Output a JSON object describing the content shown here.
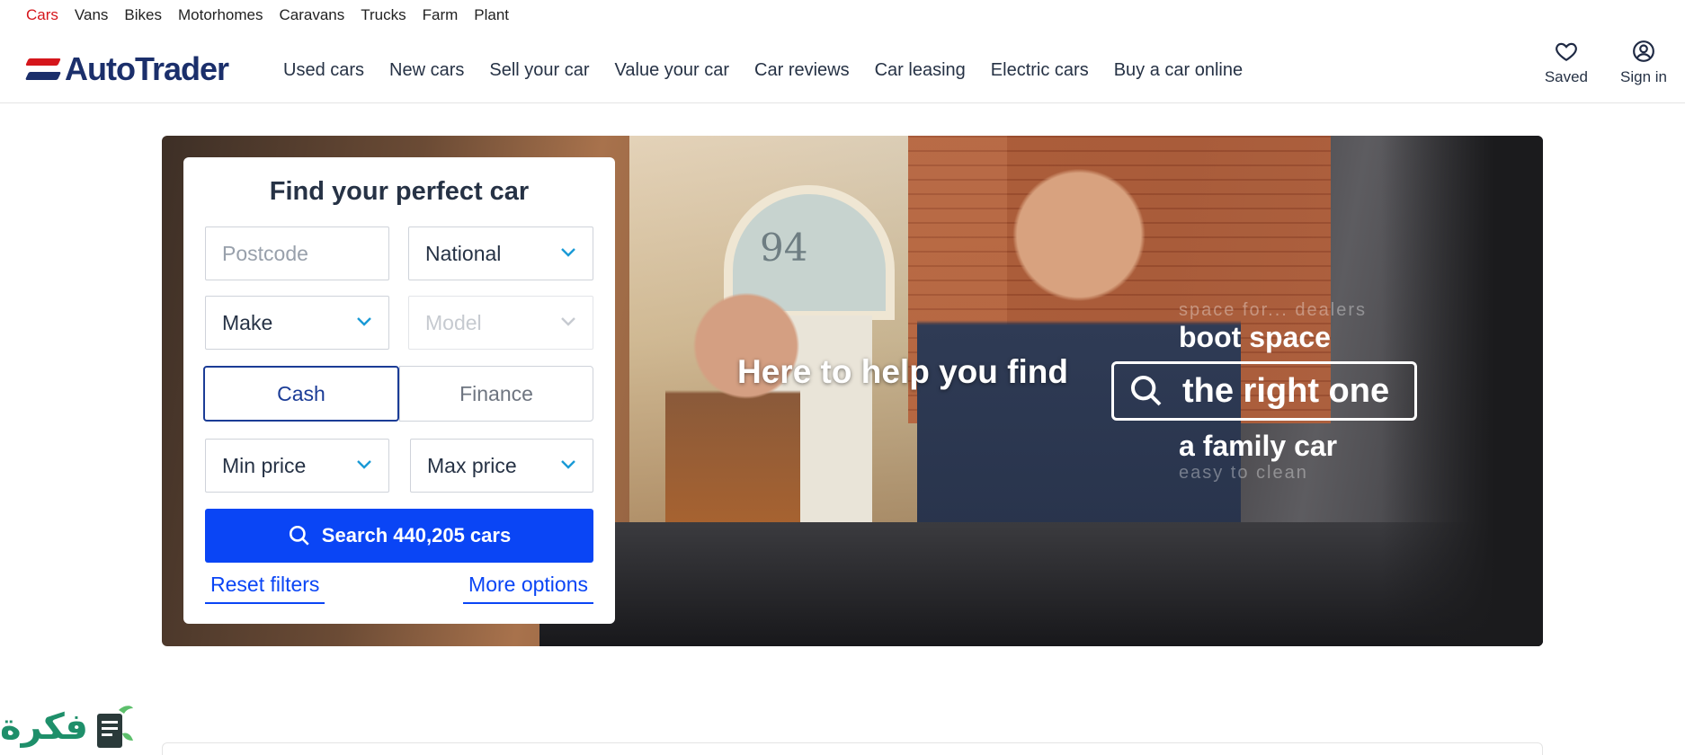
{
  "verticals": [
    "Cars",
    "Vans",
    "Bikes",
    "Motorhomes",
    "Caravans",
    "Trucks",
    "Farm",
    "Plant"
  ],
  "brand": {
    "name": "AutoTrader"
  },
  "nav": [
    "Used cars",
    "New cars",
    "Sell your car",
    "Value your car",
    "Car reviews",
    "Car leasing",
    "Electric cars",
    "Buy a car online"
  ],
  "user": {
    "saved": "Saved",
    "signin": "Sign in"
  },
  "search": {
    "title": "Find your perfect car",
    "postcode_placeholder": "Postcode",
    "distance": "National",
    "make": "Make",
    "model": "Model",
    "payment_cash": "Cash",
    "payment_finance": "Finance",
    "min_price": "Min price",
    "max_price": "Max price",
    "button": "Search 440,205 cars",
    "reset": "Reset filters",
    "more": "More options"
  },
  "hero": {
    "tagline": "Here to help you find",
    "rotator_faint_top": "space for... dealers",
    "rotator_above": "boot space",
    "rotator_current": "the right one",
    "rotator_below": "a family car",
    "rotator_faint_bottom": "easy to clean",
    "house_number": "94"
  },
  "watermark": {
    "text": "فكرة"
  },
  "colors": {
    "brand_red": "#d5161c",
    "brand_navy": "#1b2f6b",
    "cta_blue": "#0a45f5"
  }
}
